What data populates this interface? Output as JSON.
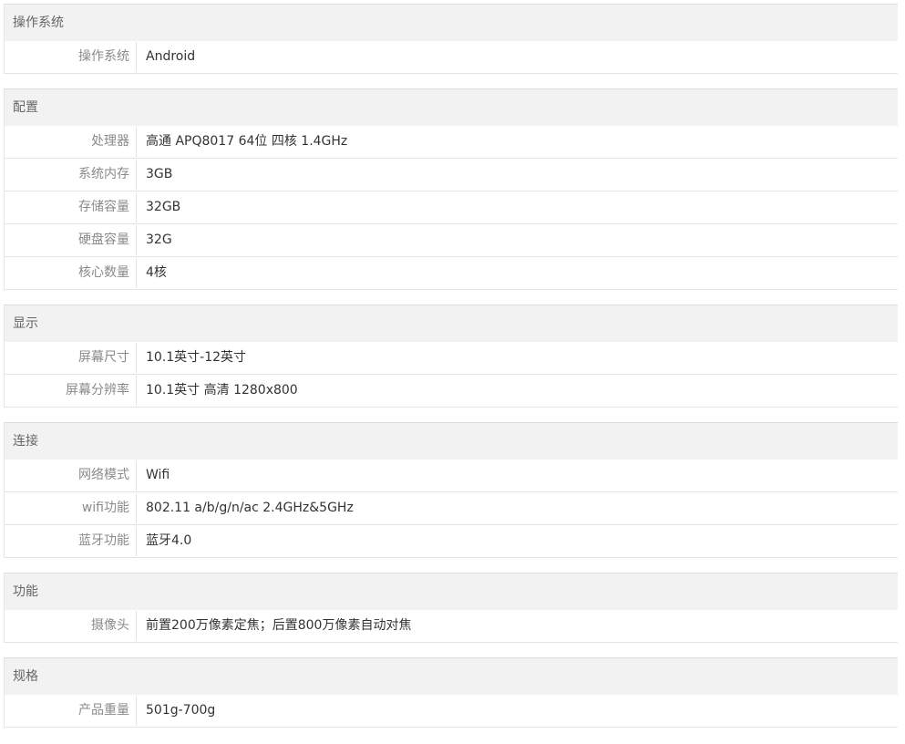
{
  "groups": [
    {
      "title": "操作系统",
      "rows": [
        {
          "label": "操作系统",
          "value": "Android"
        }
      ]
    },
    {
      "title": "配置",
      "rows": [
        {
          "label": "处理器",
          "value": "高通 APQ8017 64位 四核 1.4GHz"
        },
        {
          "label": "系统内存",
          "value": "3GB"
        },
        {
          "label": "存储容量",
          "value": "32GB"
        },
        {
          "label": "硬盘容量",
          "value": "32G"
        },
        {
          "label": "核心数量",
          "value": "4核"
        }
      ]
    },
    {
      "title": "显示",
      "rows": [
        {
          "label": "屏幕尺寸",
          "value": "10.1英寸-12英寸"
        },
        {
          "label": "屏幕分辨率",
          "value": "10.1英寸 高清 1280x800"
        }
      ]
    },
    {
      "title": "连接",
      "rows": [
        {
          "label": "网络模式",
          "value": "Wifi"
        },
        {
          "label": "wifi功能",
          "value": "802.11 a/b/g/n/ac 2.4GHz&5GHz"
        },
        {
          "label": "蓝牙功能",
          "value": "蓝牙4.0"
        }
      ]
    },
    {
      "title": "功能",
      "rows": [
        {
          "label": "摄像头",
          "value": "前置200万像素定焦；后置800万像素自动对焦"
        }
      ]
    },
    {
      "title": "规格",
      "rows": [
        {
          "label": "产品重量",
          "value": "501g-700g"
        }
      ]
    }
  ]
}
